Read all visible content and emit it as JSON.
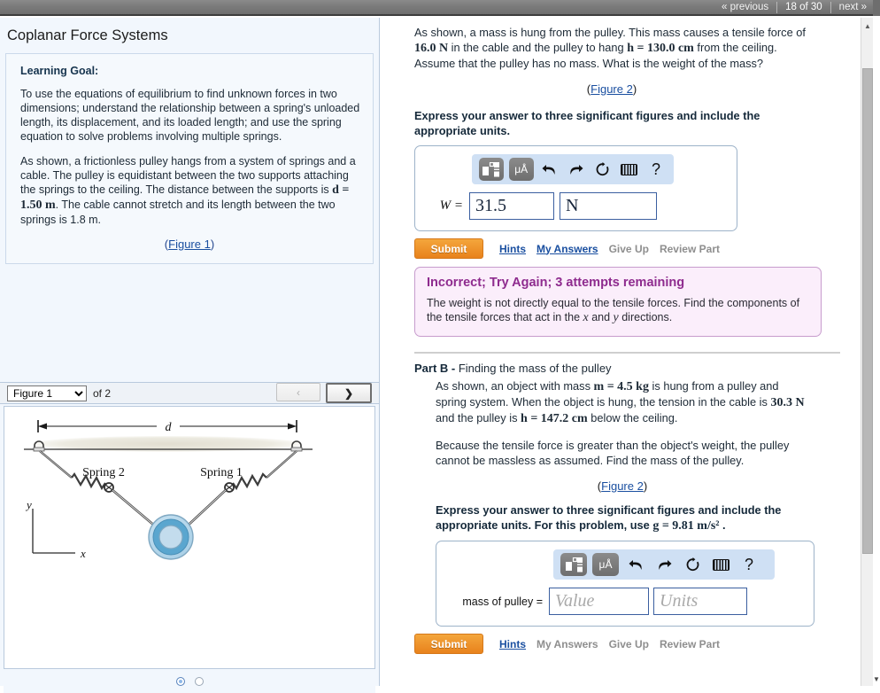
{
  "topnav": {
    "previous_label": "« previous",
    "counter": "18 of 30",
    "next_label": "next »"
  },
  "left_panel": {
    "title": "Coplanar Force Systems",
    "learning_goal_heading": "Learning Goal:",
    "goal_paragraph": "To use the equations of equilibrium to find unknown forces in two dimensions; understand the relationship between a spring's unloaded length, its displacement, and its loaded length; and use the spring equation to solve problems involving multiple springs.",
    "setup_part1": "As shown, a frictionless pulley hangs from a system of springs and a cable. The pulley is equidistant between the two supports attaching the springs to the ceiling. The distance between the supports is ",
    "setup_d": "d = 1.50 m",
    "setup_part2": ". The cable cannot stretch and its length between the two springs is 1.8 m.",
    "figure_link": "Figure 1",
    "figure_link_open": "(",
    "figure_link_close": ")"
  },
  "figure_viewer": {
    "selected_figure": "Figure 1",
    "options": [
      "Figure 1",
      "Figure 2"
    ],
    "of_label": "of 2",
    "prev_arrow": "‹",
    "next_arrow": "❯",
    "figure_caption_d": "d",
    "figure_label_spring2": "Spring 2",
    "figure_label_spring1": "Spring 1",
    "figure_axis_y": "y",
    "figure_axis_x": "x",
    "page_dots": 2,
    "active_dot": 1
  },
  "part_a": {
    "body_1": "As shown, a mass is hung from the pulley. This mass causes a tensile force of ",
    "force_value": "16.0 N",
    "body_2": " in the cable and the pulley to hang ",
    "h_value": "h = 130.0 cm",
    "body_3": " from the ceiling. Assume that the pulley has no mass. What is the weight of the mass?",
    "figure_link": "Figure 2",
    "instruction": "Express your answer to three significant figures and include the appropriate units.",
    "answer_label": "W =",
    "value_input": "31.5",
    "units_input": "N",
    "submit_label": "Submit",
    "hints_label": "Hints",
    "my_answers_label": "My Answers",
    "give_up_label": "Give Up",
    "review_part_label": "Review Part",
    "feedback_heading": "Incorrect; Try Again; 3 attempts remaining",
    "feedback_body_1": "The weight is not directly equal to the tensile forces. Find the components of the tensile forces that act in the ",
    "feedback_x": "x",
    "feedback_and": " and ",
    "feedback_y": "y",
    "feedback_body_2": " directions."
  },
  "part_b": {
    "heading_label": "Part B -",
    "heading_title": " Finding the mass of the pulley",
    "body_1": "As shown, an object with mass ",
    "mass_value": "m = 4.5 kg",
    "body_2": " is hung from a pulley and spring system. When the object is hung, the tension in the cable is ",
    "tension_value": "30.3 N",
    "body_3": " and the pulley is ",
    "h_value": "h = 147.2 cm",
    "body_4": " below the ceiling.",
    "body_5": "Because the tensile force is greater than the object's weight, the pulley cannot be massless as assumed. Find the mass of the pulley.",
    "figure_link": "Figure 2",
    "instruction_1": "Express your answer to three significant figures and include the appropriate units. For this problem, use ",
    "g_value": "g = 9.81 m/s²",
    "instruction_2": " .",
    "answer_label": "mass of pulley =",
    "value_placeholder": "Value",
    "units_placeholder": "Units",
    "submit_label": "Submit",
    "hints_label": "Hints",
    "my_answers_label": "My Answers",
    "give_up_label": "Give Up",
    "review_part_label": "Review Part"
  },
  "math_toolbar": {
    "template_icon": "template-icon",
    "units_icon": "μÅ",
    "undo_icon": "←",
    "redo_icon": "→",
    "reset_icon": "↻",
    "keyboard_icon": "keyboard-icon",
    "help_icon": "?"
  },
  "colors": {
    "accent_orange": "#e8821c",
    "link_blue": "#1a4fa0",
    "feedback_purple": "#8e2b8e",
    "panel_blue": "#f2f7fd",
    "toolbar_blue": "#cfe0f4"
  }
}
